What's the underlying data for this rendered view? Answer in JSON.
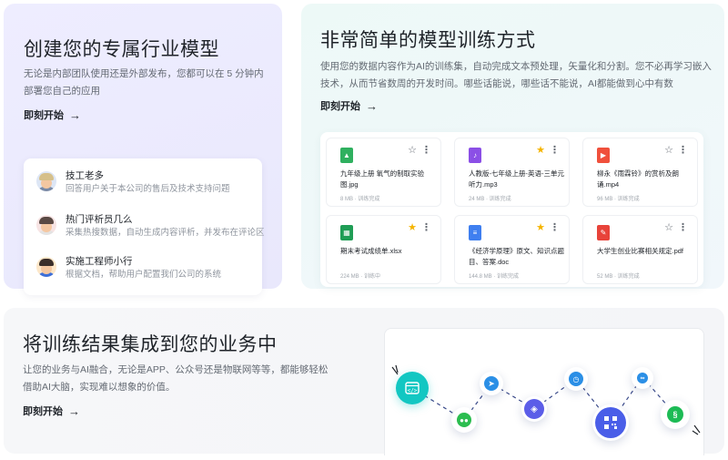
{
  "card_custom_model": {
    "title": "创建您的专属行业模型",
    "description_line1": "无论是内部团队使用还是外部发布，您都可以在 5 分钟内",
    "description_line2": "部署您自己的应用",
    "cta_label": "即刻开始",
    "cta_icon": "arrow-right-icon",
    "bots": [
      {
        "name": "技工老多",
        "description": "回答用户关于本公司的售后及技术支持问题",
        "avatar": "worker-avatar"
      },
      {
        "name": "热门评析员几么",
        "description": "采集热搜数据，自动生成内容评析，并发布在评论区",
        "avatar": "reviewer-avatar"
      },
      {
        "name": "实施工程师小行",
        "description": "根据文档，帮助用户配置我们公司的系统",
        "avatar": "engineer-avatar"
      }
    ]
  },
  "card_training": {
    "title": "非常简单的模型训练方式",
    "description_line1": "使用您的数据内容作为AI的训练集，自动完成文本预处理，矢量化和分割。您不必再学习嵌入",
    "description_line2": "技术，从而节省数周的开发时间。哪些话能说，哪些话不能说，AI都能做到心中有数",
    "cta_label": "即刻开始",
    "files": [
      {
        "name": "九年级上册 氧气的制取实验图.jpg",
        "meta": "8 MB · 训练完成",
        "type": "image",
        "color": "#2fb05f",
        "starred": false
      },
      {
        "name": "人教版-七年级上册-英语-三单元听力.mp3",
        "meta": "24 MB · 训练完成",
        "type": "audio",
        "color": "#8b4fe6",
        "starred": true
      },
      {
        "name": "柳永《雨霖铃》的赏析及朗诵.mp4",
        "meta": "96 MB · 训练完成",
        "type": "video",
        "color": "#f0503c",
        "starred": false
      },
      {
        "name": "期末考试成绩单.xlsx",
        "meta": "224 MB · 训练中",
        "type": "sheet",
        "color": "#1f9d55",
        "starred": true
      },
      {
        "name": "《经济学原理》原文、知识点题目、答案.doc",
        "meta": "144.8 MB · 训练完成",
        "type": "doc",
        "color": "#3f7ff0",
        "starred": true
      },
      {
        "name": "大学生创业比赛相关规定.pdf",
        "meta": "52 MB · 训练完成",
        "type": "pdf",
        "color": "#e8433a",
        "starred": false
      }
    ],
    "star_color": "#f5b400"
  },
  "card_integration": {
    "title": "将训练结果集成到您的业务中",
    "description_line1": "让您的业务与AI融合，无论是APP、公众号还是物联网等等，都能够轻松",
    "description_line2": "借助AI大脑，实现难以想象的价值。",
    "cta_label": "即刻开始",
    "nodes": [
      {
        "name": "code-window-icon",
        "color": "#12c7c2"
      },
      {
        "name": "wechat-icon",
        "color": "#2bbd4f"
      },
      {
        "name": "bird-icon",
        "color": "#2b8fe6"
      },
      {
        "name": "plugin-icon",
        "color": "#5b5de8"
      },
      {
        "name": "watch-icon",
        "color": "#2b8fe6"
      },
      {
        "name": "qr-code-icon",
        "color": "#4a5ee8"
      },
      {
        "name": "link-icon",
        "color": "#2b8fe6"
      },
      {
        "name": "mini-program-icon",
        "color": "#1dbb55"
      }
    ]
  }
}
